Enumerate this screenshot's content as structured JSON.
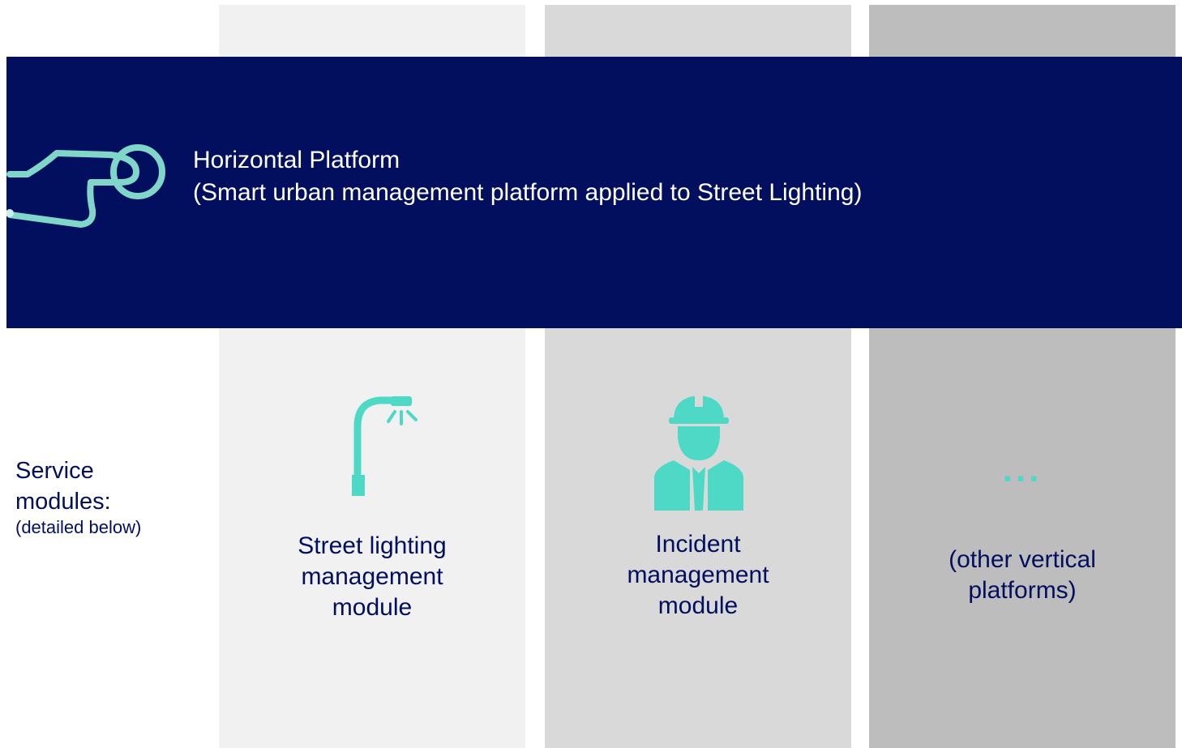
{
  "banner": {
    "title": "Horizontal Platform",
    "subtitle": "(Smart urban management platform applied to Street Lighting)",
    "icon": "pointing-hand-icon"
  },
  "side_label": {
    "main_line1": "Service",
    "main_line2": "modules:",
    "sub": "(detailed below)"
  },
  "modules": [
    {
      "icon": "street-lamp-icon",
      "lines": [
        "Street lighting",
        "management",
        "module"
      ]
    },
    {
      "icon": "worker-hardhat-icon",
      "lines": [
        "Incident",
        "management",
        "module"
      ]
    },
    {
      "icon": "ellipsis-icon",
      "dots": "...",
      "lines": [
        "(other vertical",
        "platforms)"
      ]
    }
  ],
  "colors": {
    "navy": "#020f5e",
    "teal": "#4dd9c5",
    "column_light": "#f1f1f1",
    "column_mid": "#d9d9d9",
    "column_dark": "#bdbdbd"
  }
}
